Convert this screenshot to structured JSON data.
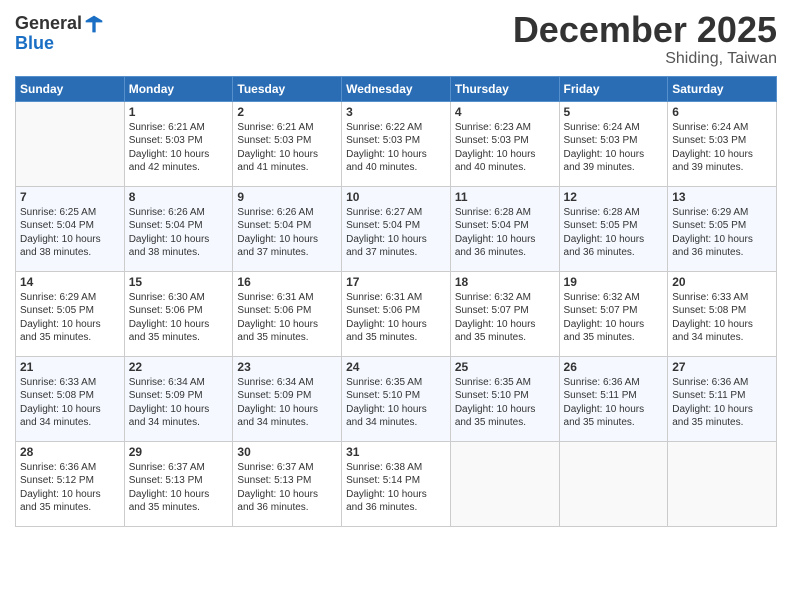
{
  "header": {
    "logo_general": "General",
    "logo_blue": "Blue",
    "month": "December 2025",
    "location": "Shiding, Taiwan"
  },
  "weekdays": [
    "Sunday",
    "Monday",
    "Tuesday",
    "Wednesday",
    "Thursday",
    "Friday",
    "Saturday"
  ],
  "weeks": [
    [
      {
        "day": "",
        "info": ""
      },
      {
        "day": "1",
        "info": "Sunrise: 6:21 AM\nSunset: 5:03 PM\nDaylight: 10 hours\nand 42 minutes."
      },
      {
        "day": "2",
        "info": "Sunrise: 6:21 AM\nSunset: 5:03 PM\nDaylight: 10 hours\nand 41 minutes."
      },
      {
        "day": "3",
        "info": "Sunrise: 6:22 AM\nSunset: 5:03 PM\nDaylight: 10 hours\nand 40 minutes."
      },
      {
        "day": "4",
        "info": "Sunrise: 6:23 AM\nSunset: 5:03 PM\nDaylight: 10 hours\nand 40 minutes."
      },
      {
        "day": "5",
        "info": "Sunrise: 6:24 AM\nSunset: 5:03 PM\nDaylight: 10 hours\nand 39 minutes."
      },
      {
        "day": "6",
        "info": "Sunrise: 6:24 AM\nSunset: 5:03 PM\nDaylight: 10 hours\nand 39 minutes."
      }
    ],
    [
      {
        "day": "7",
        "info": "Sunrise: 6:25 AM\nSunset: 5:04 PM\nDaylight: 10 hours\nand 38 minutes."
      },
      {
        "day": "8",
        "info": "Sunrise: 6:26 AM\nSunset: 5:04 PM\nDaylight: 10 hours\nand 38 minutes."
      },
      {
        "day": "9",
        "info": "Sunrise: 6:26 AM\nSunset: 5:04 PM\nDaylight: 10 hours\nand 37 minutes."
      },
      {
        "day": "10",
        "info": "Sunrise: 6:27 AM\nSunset: 5:04 PM\nDaylight: 10 hours\nand 37 minutes."
      },
      {
        "day": "11",
        "info": "Sunrise: 6:28 AM\nSunset: 5:04 PM\nDaylight: 10 hours\nand 36 minutes."
      },
      {
        "day": "12",
        "info": "Sunrise: 6:28 AM\nSunset: 5:05 PM\nDaylight: 10 hours\nand 36 minutes."
      },
      {
        "day": "13",
        "info": "Sunrise: 6:29 AM\nSunset: 5:05 PM\nDaylight: 10 hours\nand 36 minutes."
      }
    ],
    [
      {
        "day": "14",
        "info": "Sunrise: 6:29 AM\nSunset: 5:05 PM\nDaylight: 10 hours\nand 35 minutes."
      },
      {
        "day": "15",
        "info": "Sunrise: 6:30 AM\nSunset: 5:06 PM\nDaylight: 10 hours\nand 35 minutes."
      },
      {
        "day": "16",
        "info": "Sunrise: 6:31 AM\nSunset: 5:06 PM\nDaylight: 10 hours\nand 35 minutes."
      },
      {
        "day": "17",
        "info": "Sunrise: 6:31 AM\nSunset: 5:06 PM\nDaylight: 10 hours\nand 35 minutes."
      },
      {
        "day": "18",
        "info": "Sunrise: 6:32 AM\nSunset: 5:07 PM\nDaylight: 10 hours\nand 35 minutes."
      },
      {
        "day": "19",
        "info": "Sunrise: 6:32 AM\nSunset: 5:07 PM\nDaylight: 10 hours\nand 35 minutes."
      },
      {
        "day": "20",
        "info": "Sunrise: 6:33 AM\nSunset: 5:08 PM\nDaylight: 10 hours\nand 34 minutes."
      }
    ],
    [
      {
        "day": "21",
        "info": "Sunrise: 6:33 AM\nSunset: 5:08 PM\nDaylight: 10 hours\nand 34 minutes."
      },
      {
        "day": "22",
        "info": "Sunrise: 6:34 AM\nSunset: 5:09 PM\nDaylight: 10 hours\nand 34 minutes."
      },
      {
        "day": "23",
        "info": "Sunrise: 6:34 AM\nSunset: 5:09 PM\nDaylight: 10 hours\nand 34 minutes."
      },
      {
        "day": "24",
        "info": "Sunrise: 6:35 AM\nSunset: 5:10 PM\nDaylight: 10 hours\nand 34 minutes."
      },
      {
        "day": "25",
        "info": "Sunrise: 6:35 AM\nSunset: 5:10 PM\nDaylight: 10 hours\nand 35 minutes."
      },
      {
        "day": "26",
        "info": "Sunrise: 6:36 AM\nSunset: 5:11 PM\nDaylight: 10 hours\nand 35 minutes."
      },
      {
        "day": "27",
        "info": "Sunrise: 6:36 AM\nSunset: 5:11 PM\nDaylight: 10 hours\nand 35 minutes."
      }
    ],
    [
      {
        "day": "28",
        "info": "Sunrise: 6:36 AM\nSunset: 5:12 PM\nDaylight: 10 hours\nand 35 minutes."
      },
      {
        "day": "29",
        "info": "Sunrise: 6:37 AM\nSunset: 5:13 PM\nDaylight: 10 hours\nand 35 minutes."
      },
      {
        "day": "30",
        "info": "Sunrise: 6:37 AM\nSunset: 5:13 PM\nDaylight: 10 hours\nand 36 minutes."
      },
      {
        "day": "31",
        "info": "Sunrise: 6:38 AM\nSunset: 5:14 PM\nDaylight: 10 hours\nand 36 minutes."
      },
      {
        "day": "",
        "info": ""
      },
      {
        "day": "",
        "info": ""
      },
      {
        "day": "",
        "info": ""
      }
    ]
  ]
}
